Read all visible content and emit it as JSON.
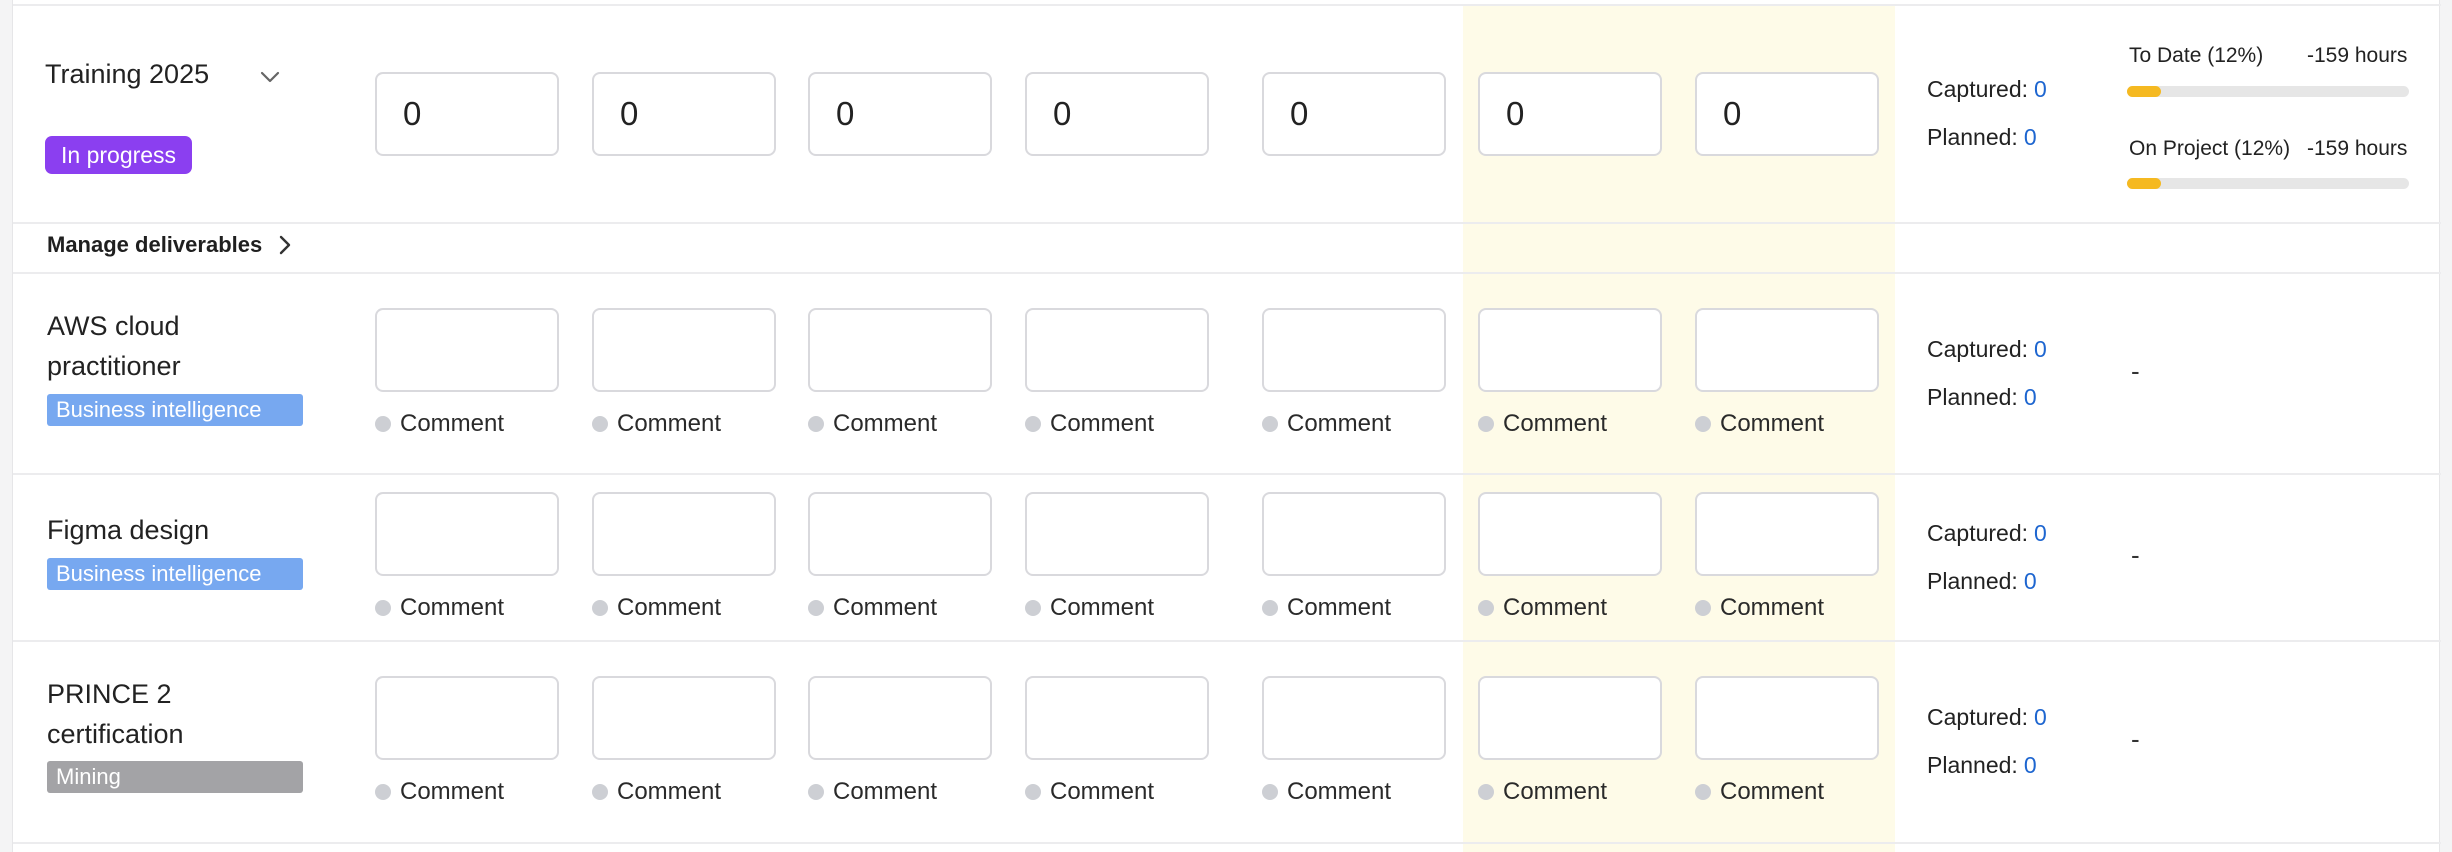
{
  "main_task": {
    "name": "Training 2025",
    "status": "In progress",
    "hours": [
      "0",
      "0",
      "0",
      "0",
      "0",
      "0",
      "0"
    ],
    "captured_label": "Captured:",
    "captured_value": "0",
    "planned_label": "Planned:",
    "planned_value": "0",
    "to_date_label": "To Date (12%)",
    "to_date_hours": "-159 hours",
    "to_date_fraction": 0.12,
    "on_project_label": "On Project (12%)",
    "on_project_hours": "-159 hours",
    "on_project_fraction": 0.12
  },
  "manage_label": "Manage deliverables",
  "comment_label": "Comment",
  "deliverables": [
    {
      "name_line1": "AWS cloud",
      "name_line2": "practitioner",
      "tag": "Business intelligence",
      "captured_label": "Captured:",
      "captured_value": "0",
      "planned_label": "Planned:",
      "planned_value": "0",
      "progress": "-"
    },
    {
      "name_line1": "Figma design",
      "tag": "Business intelligence",
      "captured_label": "Captured:",
      "captured_value": "0",
      "planned_label": "Planned:",
      "planned_value": "0",
      "progress": "-"
    },
    {
      "name_line1": "PRINCE 2",
      "name_line2": "certification",
      "tag": "Mining",
      "captured_label": "Captured:",
      "captured_value": "0",
      "planned_label": "Planned:",
      "planned_value": "0",
      "progress": "-"
    }
  ],
  "colors": {
    "status_purple": "#8b3ff0",
    "tag_business_intelligence": "#77a8f0",
    "tag_mining": "#a3a3a6",
    "value_blue": "#1e66d0",
    "progress_yellow": "#f5b921",
    "highlight_column": "#fefbe8"
  }
}
